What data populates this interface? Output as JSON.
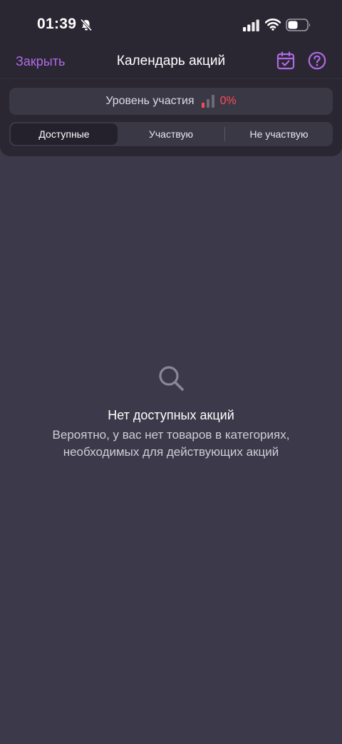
{
  "status_bar": {
    "time": "01:39"
  },
  "header": {
    "close_label": "Закрыть",
    "title": "Календарь акций",
    "accent_color": "#b06ae6"
  },
  "participation": {
    "label": "Уровень участия",
    "value": "0%",
    "value_color": "#ff4a55"
  },
  "tabs": [
    {
      "label": "Доступные",
      "selected": true
    },
    {
      "label": "Участвую",
      "selected": false
    },
    {
      "label": "Не участвую",
      "selected": false
    }
  ],
  "empty_state": {
    "icon": "search-icon",
    "title": "Нет доступных акций",
    "line1": "Вероятно, у вас нет товаров в категориях,",
    "line2": "необходимых для действующих акций"
  },
  "icons": {
    "status": [
      "bell-off-icon",
      "signal-icon",
      "wifi-icon",
      "battery-icon"
    ],
    "header": [
      "calendar-check-icon",
      "help-icon"
    ],
    "participation": "level-bars-icon"
  }
}
